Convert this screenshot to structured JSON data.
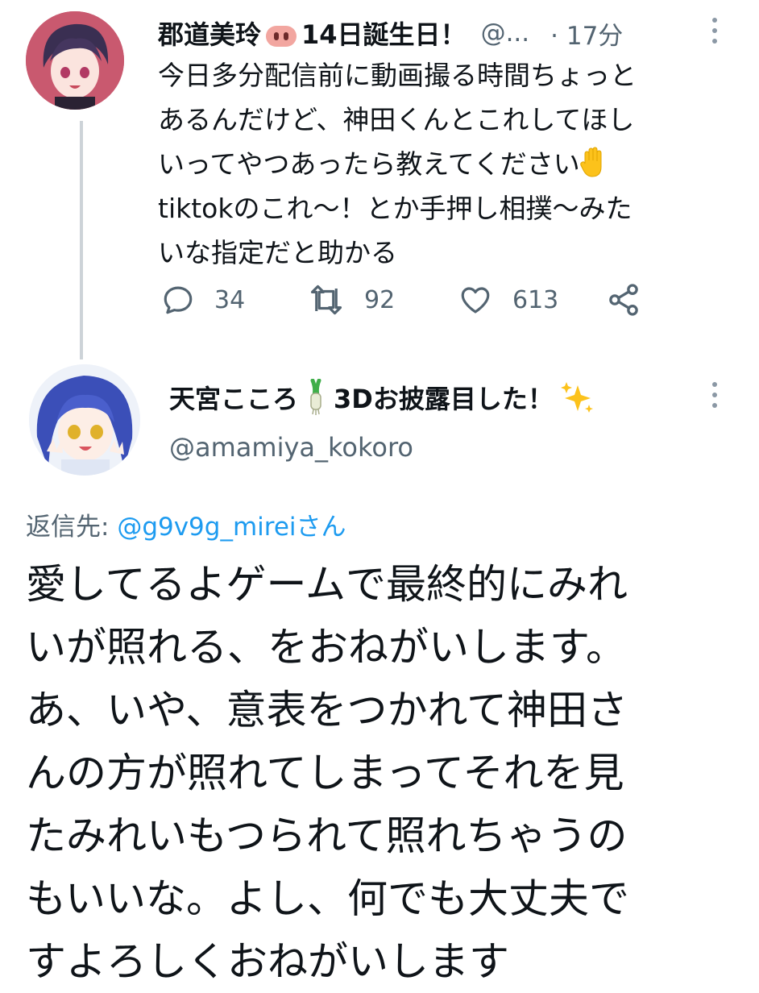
{
  "tweet1": {
    "display_name": "郡道美玲",
    "name_emoji": "pig-nose-icon",
    "name_suffix": "14日誕生日！",
    "handle": "@...",
    "separator": "·",
    "time": "17分",
    "text": "今日多分配信前に動画撮る時間ちょっと\nあるんだけど、神田くんとこれしてほし\nいってやつあったら教えてください",
    "text_emoji": "raised-hand-icon",
    "text_rest": "\ntiktokのこれ〜！とか手押し相撲〜みた\nいな指定だと助かる",
    "replies": "34",
    "retweets": "92",
    "likes": "613"
  },
  "tweet2": {
    "display_name": "天宮こころ",
    "name_emoji": "green-onion-icon",
    "name_suffix": "3Dお披露目した！",
    "name_emoji2": "sparkles-icon",
    "handle": "@amamiya_kokoro",
    "replying_label": "返信先:",
    "replying_to": "@g9v9g_mireiさん",
    "text": "愛してるよゲームで最終的にみれ\nいが照れる、をおねがいします。\nあ、いや、意表をつかれて神田さ\nんの方が照れてしまってそれを見\nたみれいもつられて照れちゃうの\nもいいな。よし、何でも大丈夫で\nすよろしくおねがいします"
  },
  "colors": {
    "text_primary": "#0f1419",
    "text_secondary": "#536471",
    "link": "#1d9bf0",
    "thread_line": "#cdd3d8"
  }
}
